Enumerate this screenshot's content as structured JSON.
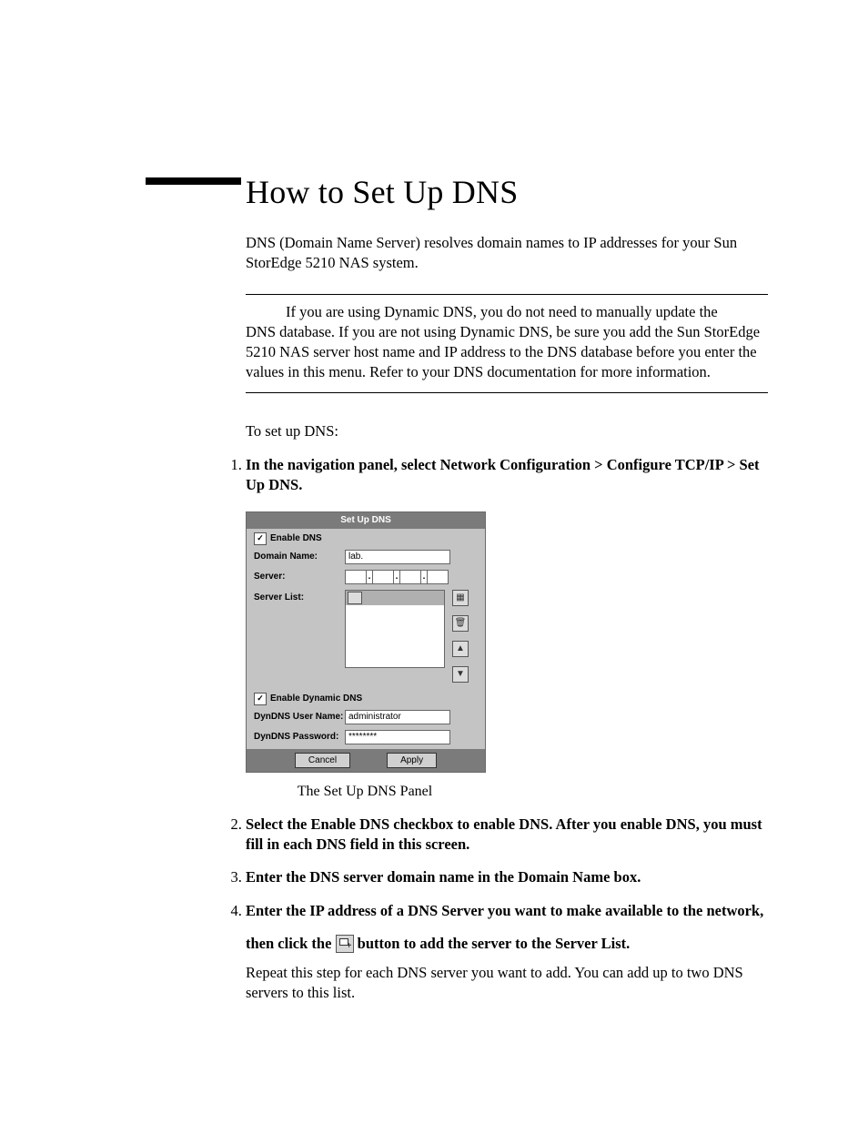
{
  "heading": "How to Set Up DNS",
  "intro": "DNS (Domain Name Server) resolves domain names to IP addresses for your Sun StorEdge 5210 NAS system.",
  "note_line1": "If you are using Dynamic DNS, you do not need to manually update the",
  "note_rest": "DNS database. If you are not using Dynamic DNS, be sure you add the Sun StorEdge 5210 NAS server host name and IP address to the DNS database before you enter the values in this menu. Refer to your DNS documentation for more information.",
  "lead_in": "To set up DNS:",
  "steps": {
    "s1": "In the navigation panel, select Network Configuration > Configure TCP/IP > Set Up DNS.",
    "s2": "Select the Enable DNS checkbox to enable DNS. After you enable DNS, you must fill in each DNS field in this screen.",
    "s3": "Enter the DNS server domain name in the Domain Name box.",
    "s4a": "Enter the IP address of a DNS Server you want to make available to the network,",
    "s4b_pre": "then click the ",
    "s4b_post": " button to add the server to the Server List.",
    "s4_follow": "Repeat this step for each DNS server you want to add. You can add up to two DNS servers to this list."
  },
  "panel": {
    "title": "Set Up DNS",
    "enable_dns": "Enable DNS",
    "domain_name_lbl": "Domain Name:",
    "domain_name_val": "lab.",
    "server_lbl": "Server:",
    "server_list_lbl": "Server List:",
    "enable_dyn_dns": "Enable Dynamic DNS",
    "dyn_user_lbl": "DynDNS User Name:",
    "dyn_user_val": "administrator",
    "dyn_pass_lbl": "DynDNS Password:",
    "dyn_pass_val": "********",
    "cancel": "Cancel",
    "apply": "Apply"
  },
  "caption": "The Set Up DNS Panel"
}
